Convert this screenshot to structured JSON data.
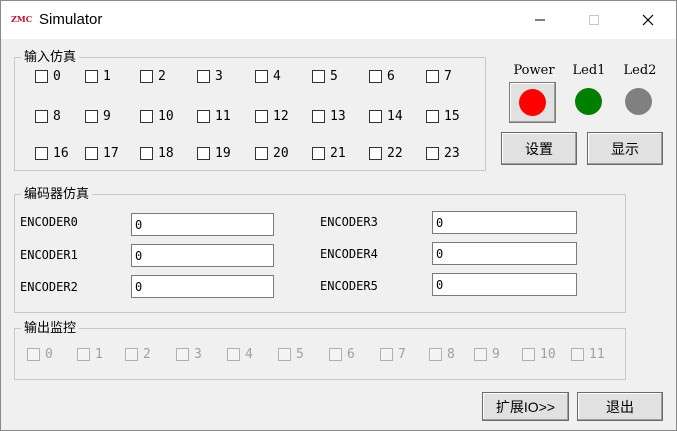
{
  "window": {
    "logo_text": "ZMC",
    "title": "Simulator"
  },
  "input_sim": {
    "title": "输入仿真",
    "items": [
      "0",
      "1",
      "2",
      "3",
      "4",
      "5",
      "6",
      "7",
      "8",
      "9",
      "10",
      "11",
      "12",
      "13",
      "14",
      "15",
      "16",
      "17",
      "18",
      "19",
      "20",
      "21",
      "22",
      "23"
    ]
  },
  "leds": {
    "power_label": "Power",
    "led1_label": "Led1",
    "led2_label": "Led2",
    "power_color": "#ff0000",
    "led1_color": "#008000",
    "led2_color": "#808080"
  },
  "buttons": {
    "settings": "设置",
    "display": "显示",
    "expand_io": "扩展IO>>",
    "exit": "退出"
  },
  "encoder_sim": {
    "title": "编码器仿真",
    "encoders": [
      {
        "label": "ENCODER0",
        "value": "0"
      },
      {
        "label": "ENCODER1",
        "value": "0"
      },
      {
        "label": "ENCODER2",
        "value": "0"
      },
      {
        "label": "ENCODER3",
        "value": "0"
      },
      {
        "label": "ENCODER4",
        "value": "0"
      },
      {
        "label": "ENCODER5",
        "value": "0"
      }
    ]
  },
  "output_monitor": {
    "title": "输出监控",
    "items": [
      "0",
      "1",
      "2",
      "3",
      "4",
      "5",
      "6",
      "7",
      "8",
      "9",
      "10",
      "11"
    ]
  }
}
